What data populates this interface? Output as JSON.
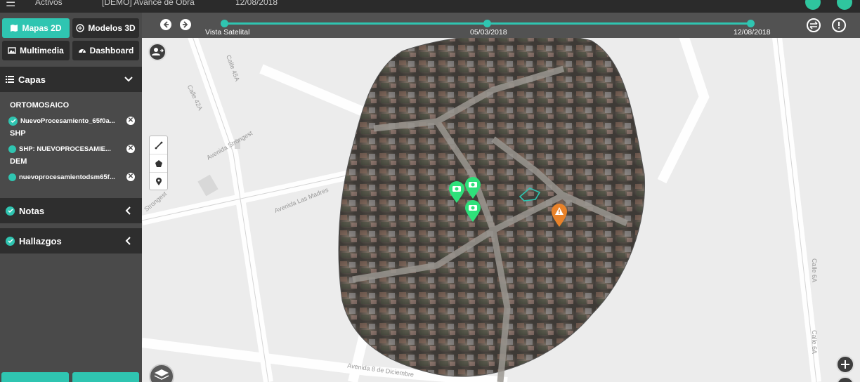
{
  "topbar": {
    "crumbs": [
      "Activos",
      "[DEMO] Avance de Obra",
      "12/08/2018"
    ]
  },
  "sidebar": {
    "tabs": [
      {
        "label": "Mapas 2D",
        "icon": "map-icon",
        "active": true
      },
      {
        "label": "Modelos 3D",
        "icon": "cube-icon",
        "active": false
      },
      {
        "label": "Multimedia",
        "icon": "image-icon",
        "active": false
      },
      {
        "label": "Dashboard",
        "icon": "dashboard-icon",
        "active": false
      }
    ],
    "layers_title": "Capas",
    "groups": [
      {
        "title": "ORTOMOSAICO",
        "layer": "NuevoProcesamiento_65f0a..."
      },
      {
        "title": "SHP",
        "layer": "SHP: NUEVOPROCESAMIE..."
      },
      {
        "title": "DEM",
        "layer": "nuevoprocesamientodsm65f..."
      }
    ],
    "notes_title": "Notas",
    "findings_title": "Hallazgos"
  },
  "timeline": {
    "labels": [
      "Vista Satelital",
      "05/03/2018",
      "12/08/2018"
    ]
  },
  "streets": {
    "s1": "Calle 45A",
    "s2": "Calle 42A",
    "s3": "Avenida Strongest",
    "s4": "Avenida Las Madres",
    "s5": "Strongest",
    "s6": "Calle 6A",
    "s7": "Calle 6A",
    "s8": "Avenida 8 de Diciembre"
  },
  "colors": {
    "accent": "#2fc5b1",
    "marker_green": "#2ee07a",
    "marker_orange": "#e8822a"
  }
}
